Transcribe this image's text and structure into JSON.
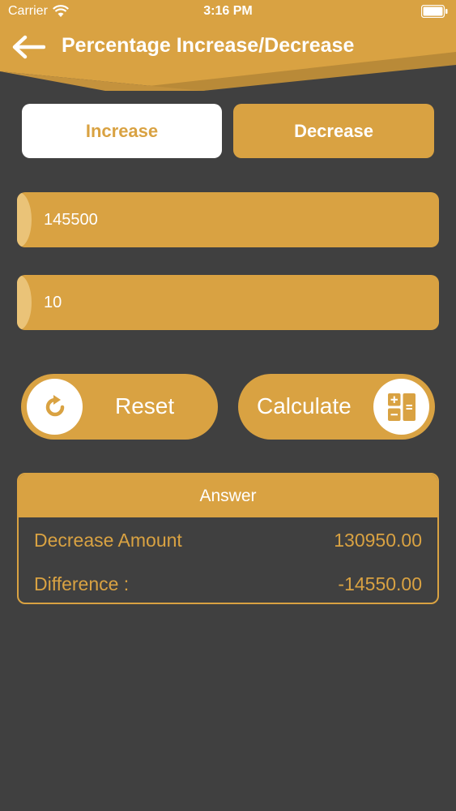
{
  "status_bar": {
    "carrier": "Carrier",
    "time": "3:16 PM"
  },
  "header": {
    "title": "Percentage Increase/Decrease"
  },
  "toggle": {
    "increase_label": "Increase",
    "decrease_label": "Decrease",
    "selected": "Decrease"
  },
  "inputs": {
    "amount_value": "145500",
    "percent_value": "10"
  },
  "actions": {
    "reset_label": "Reset",
    "calculate_label": "Calculate"
  },
  "answer": {
    "heading": "Answer",
    "rows": [
      {
        "label": "Decrease Amount",
        "value": "130950.00"
      },
      {
        "label": "Difference :",
        "value": "-14550.00"
      }
    ]
  },
  "colors": {
    "accent": "#d9a242",
    "background": "#404040",
    "selected_toggle_bg": "#ffffff"
  },
  "icons": {
    "back": "arrow-left-icon",
    "reset": "refresh-icon",
    "calculate": "calculator-icon"
  }
}
